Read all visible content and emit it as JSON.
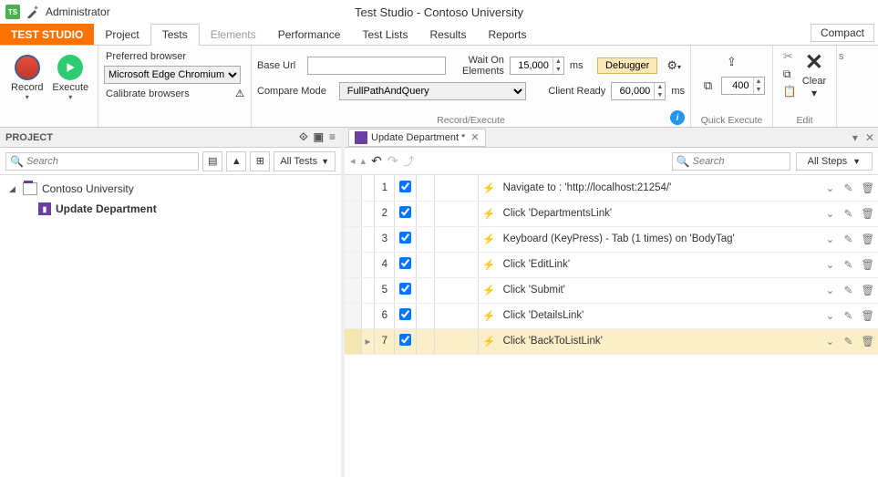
{
  "titlebar": {
    "app_badge": "TS",
    "admin": "Administrator",
    "title": "Test Studio - Contoso University"
  },
  "menubar": {
    "studio": "TEST STUDIO",
    "items": [
      "Project",
      "Tests",
      "Elements",
      "Performance",
      "Test Lists",
      "Results",
      "Reports"
    ],
    "compact": "Compact"
  },
  "ribbon": {
    "record": "Record",
    "execute": "Execute",
    "preferred_browser": "Preferred browser",
    "browser_value": "Microsoft Edge Chromium",
    "calibrate": "Calibrate browsers",
    "base_url": "Base Url",
    "base_url_value": "",
    "compare_mode": "Compare Mode",
    "compare_mode_value": "FullPathAndQuery",
    "wait_on_elements": "Wait On Elements",
    "wait_value": "15,000",
    "client_ready": "Client Ready",
    "client_value": "60,000",
    "ms": "ms",
    "debugger": "Debugger",
    "delay_value": "400",
    "clear": "Clear",
    "group_record_execute": "Record/Execute",
    "group_quick": "Quick Execute",
    "group_edit": "Edit"
  },
  "sidebar": {
    "title": "PROJECT",
    "search_ph": "Search",
    "all_tests": "All Tests",
    "project_name": "Contoso University",
    "test_name": "Update Department"
  },
  "doc": {
    "tab_title": "Update Department *",
    "search_ph": "Search",
    "all_steps": "All Steps"
  },
  "steps": [
    {
      "n": "1",
      "desc": "Navigate to : 'http://localhost:21254/'"
    },
    {
      "n": "2",
      "desc": "Click 'DepartmentsLink'"
    },
    {
      "n": "3",
      "desc": "Keyboard (KeyPress) - Tab (1 times) on 'BodyTag'"
    },
    {
      "n": "4",
      "desc": "Click 'EditLink'"
    },
    {
      "n": "5",
      "desc": "Click 'Submit'"
    },
    {
      "n": "6",
      "desc": "Click 'DetailsLink'"
    },
    {
      "n": "7",
      "desc": "Click 'BackToListLink'"
    }
  ]
}
